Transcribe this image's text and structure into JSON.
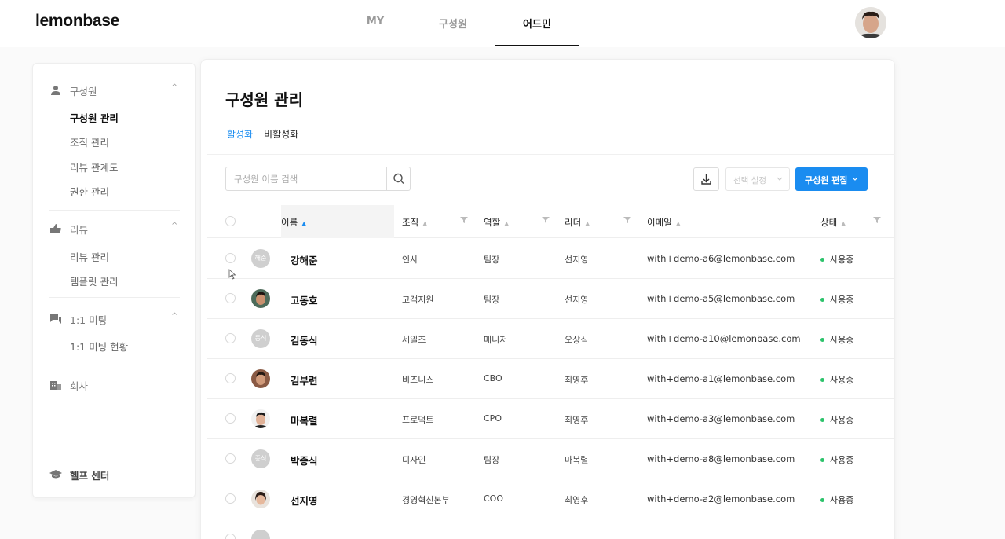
{
  "app": {
    "logo": "lemonbase",
    "nav_tabs": [
      {
        "label": "MY",
        "active": false
      },
      {
        "label": "구성원",
        "active": false
      },
      {
        "label": "어드민",
        "active": true
      }
    ]
  },
  "sidebar": {
    "groups": [
      {
        "label": "구성원",
        "icon": "person-icon",
        "expanded": true,
        "items": [
          "구성원 관리",
          "조직 관리",
          "리뷰 관계도",
          "권한 관리"
        ],
        "active_item": "구성원 관리"
      },
      {
        "label": "리뷰",
        "icon": "thumbs-up-icon",
        "expanded": true,
        "items": [
          "리뷰 관리",
          "템플릿 관리"
        ]
      },
      {
        "label": "1:1 미팅",
        "icon": "chat-icon",
        "expanded": true,
        "items": [
          "1:1 미팅 현황"
        ]
      },
      {
        "label": "회사",
        "icon": "building-icon",
        "expanded": false,
        "items": []
      }
    ],
    "help": {
      "label": "헬프 센터",
      "icon": "graduation-cap-icon"
    }
  },
  "main": {
    "title": "구성원 관리",
    "tabs": [
      {
        "label": "활성화",
        "active": true
      },
      {
        "label": "비활성화",
        "active": false
      }
    ],
    "search": {
      "placeholder": "구성원 이름 검색",
      "value": ""
    },
    "select_label": "선택 설정",
    "edit_button": "구성원 편집",
    "columns": [
      "이름",
      "조직",
      "역할",
      "리더",
      "이메일",
      "상태"
    ],
    "rows": [
      {
        "avatar_text": "해준",
        "name": "강해준",
        "org": "인사",
        "role": "팀장",
        "leader": "선지영",
        "email": "with+demo-a6@lemonbase.com",
        "status": "사용중"
      },
      {
        "avatar_text": "",
        "name": "고동호",
        "org": "고객지원",
        "role": "팀장",
        "leader": "선지영",
        "email": "with+demo-a5@lemonbase.com",
        "status": "사용중"
      },
      {
        "avatar_text": "동식",
        "name": "김동식",
        "org": "세일즈",
        "role": "매니저",
        "leader": "오상식",
        "email": "with+demo-a10@lemonbase.com",
        "status": "사용중"
      },
      {
        "avatar_text": "",
        "name": "김부련",
        "org": "비즈니스",
        "role": "CBO",
        "leader": "최영후",
        "email": "with+demo-a1@lemonbase.com",
        "status": "사용중"
      },
      {
        "avatar_text": "",
        "name": "마복렬",
        "org": "프로덕트",
        "role": "CPO",
        "leader": "최영후",
        "email": "with+demo-a3@lemonbase.com",
        "status": "사용중"
      },
      {
        "avatar_text": "종식",
        "name": "박종식",
        "org": "디자인",
        "role": "팀장",
        "leader": "마복렬",
        "email": "with+demo-a8@lemonbase.com",
        "status": "사용중"
      },
      {
        "avatar_text": "",
        "name": "선지영",
        "org": "경영혁신본부",
        "role": "COO",
        "leader": "최영후",
        "email": "with+demo-a2@lemonbase.com",
        "status": "사용중"
      }
    ]
  },
  "colors": {
    "accent": "#1a8cf0",
    "status_active": "#2cc36b"
  }
}
